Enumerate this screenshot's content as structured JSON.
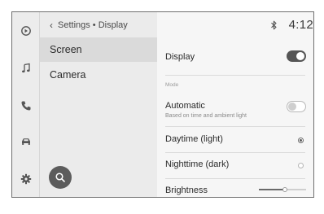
{
  "header": {
    "breadcrumb": "Settings • Display",
    "time": "4:12"
  },
  "rail": {
    "icons": [
      "apps-icon",
      "music-note-icon",
      "phone-icon",
      "car-icon",
      "gear-icon"
    ]
  },
  "menu": {
    "items": [
      {
        "label": "Screen",
        "selected": true
      },
      {
        "label": "Camera",
        "selected": false
      }
    ]
  },
  "settings": {
    "display": {
      "label": "Display",
      "on": true
    },
    "mode_header": "Mode",
    "automatic": {
      "label": "Automatic",
      "sublabel": "Based on time and ambient light",
      "on": false
    },
    "options": [
      {
        "label": "Daytime (light)",
        "selected": true
      },
      {
        "label": "Nighttime (dark)",
        "selected": false
      }
    ],
    "brightness": {
      "label": "Brightness",
      "level": 0.55
    }
  },
  "colors": {
    "toggle_on": "#555555",
    "search_button": "#5c5c5c"
  }
}
